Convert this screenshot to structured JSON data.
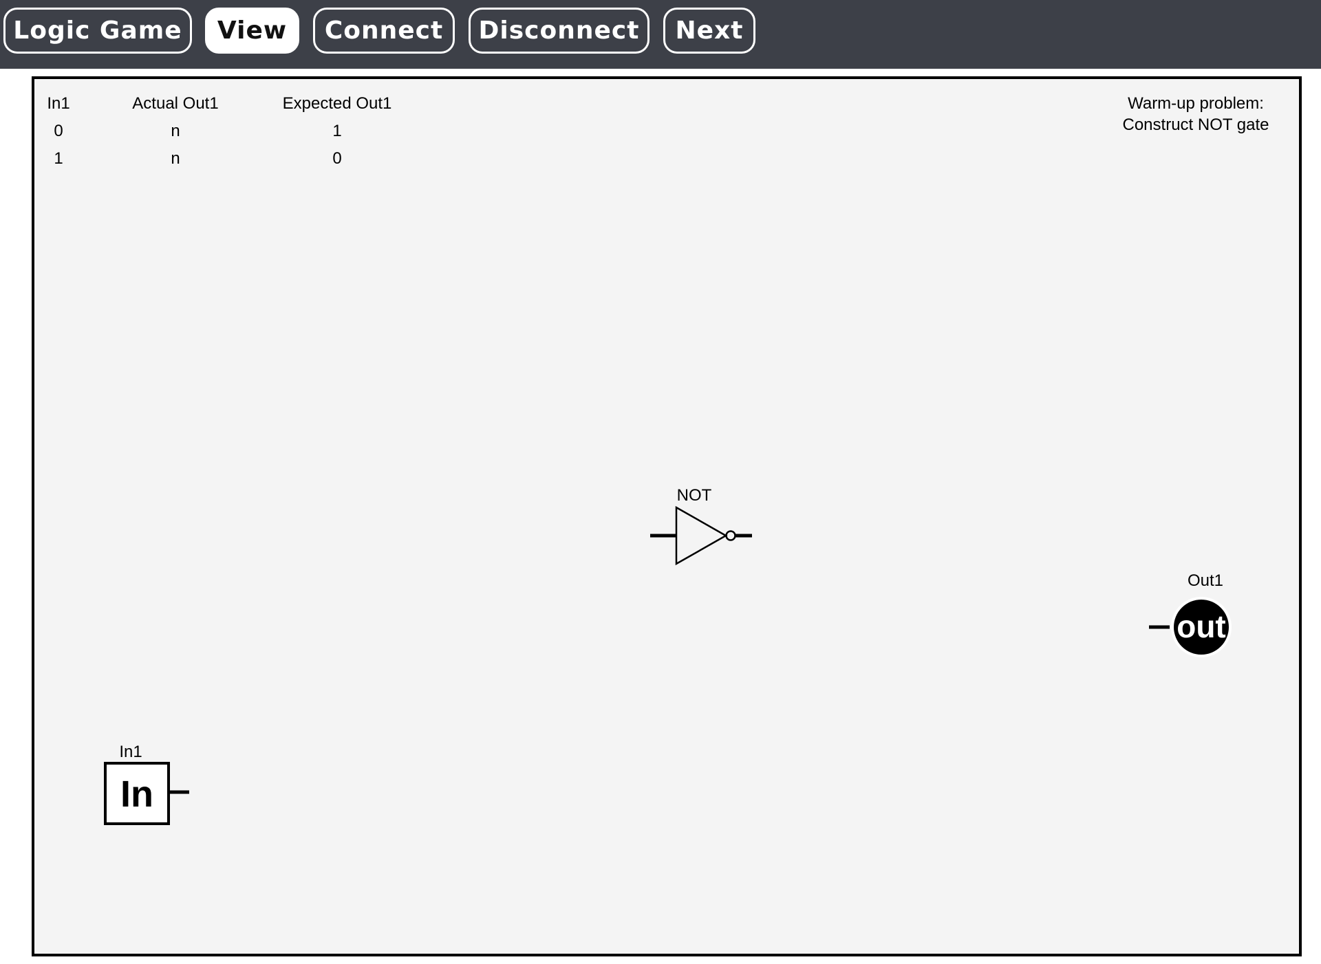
{
  "toolbar": {
    "buttons": [
      {
        "label": "Logic Game",
        "active": false
      },
      {
        "label": "View",
        "active": true
      },
      {
        "label": "Connect",
        "active": false
      },
      {
        "label": "Disconnect",
        "active": false
      },
      {
        "label": "Next",
        "active": false
      }
    ]
  },
  "truth_table": {
    "headers": [
      "In1",
      "Actual Out1",
      "Expected Out1"
    ],
    "rows": [
      [
        "0",
        "n",
        "1"
      ],
      [
        "1",
        "n",
        "0"
      ]
    ]
  },
  "problem": {
    "line1": "Warm-up problem:",
    "line2": "Construct NOT gate"
  },
  "components": {
    "not_gate": {
      "label": "NOT"
    },
    "output": {
      "label": "Out1",
      "symbol": "out"
    },
    "input": {
      "label": "In1",
      "symbol": "In"
    }
  },
  "colors": {
    "topbar": "#3d4048",
    "board_background": "#f4f4f4"
  }
}
